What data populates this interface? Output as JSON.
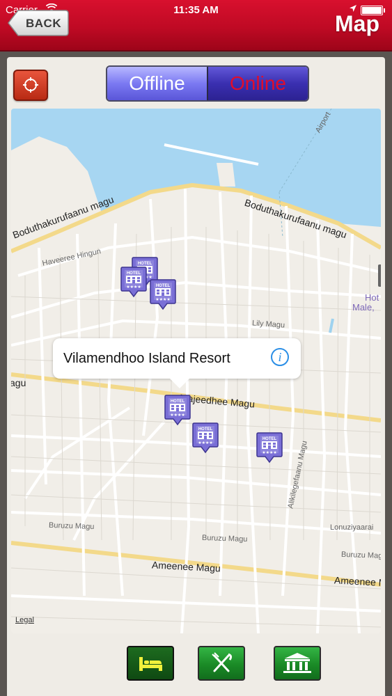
{
  "status_bar": {
    "carrier": "Carrier",
    "time": "11:35 AM"
  },
  "header": {
    "back_label": "BACK",
    "title": "Map",
    "color": "#c20c27"
  },
  "mode_switch": {
    "offline_label": "Offline",
    "online_label": "Online",
    "selected": "Offline"
  },
  "map": {
    "streets": [
      "Boduthakurufaanu magu",
      "Boduthakurufaanu magu",
      "Haveeree Hingun",
      "Airport",
      "Lily Magu",
      "Majeedhee Magu",
      "Alikilegefaanu Magu",
      "Buruzu Magu",
      "Buruzu Magu",
      "Buruzu Magu",
      "Lonuziyaarai",
      "Ameenee Magu",
      "Ameenee Magu",
      "Hot",
      "Male,",
      "agu"
    ],
    "legal": "Legal",
    "callout": {
      "name": "Vilamendhoo Island Resort",
      "info_icon": "info-icon"
    },
    "pin_icon": "hotel-pin-icon",
    "pin_label": "HOTEL"
  },
  "toolbar": {
    "items": [
      {
        "icon": "bed-icon",
        "active": true
      },
      {
        "icon": "fork-knife-icon",
        "active": false
      },
      {
        "icon": "museum-icon",
        "active": false
      }
    ]
  }
}
